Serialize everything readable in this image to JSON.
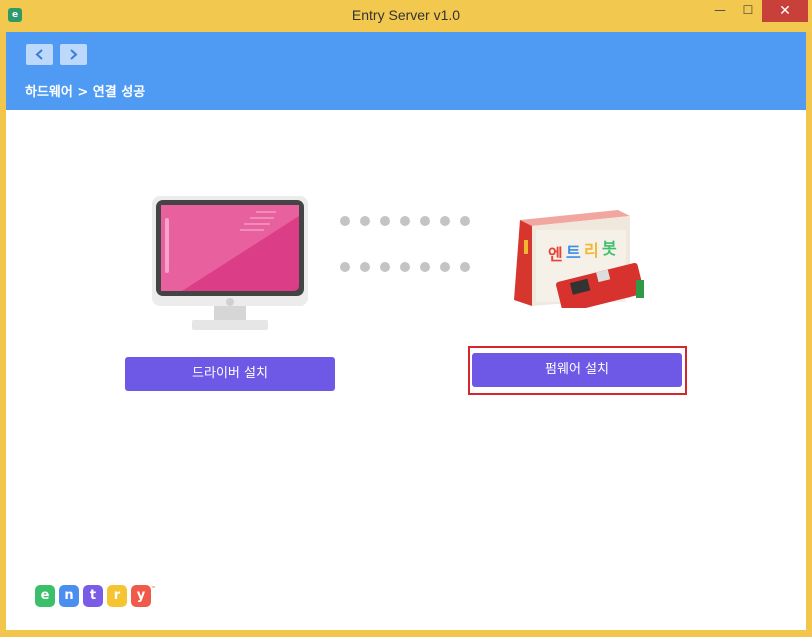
{
  "window": {
    "title": "Entry Server v1.0",
    "app_icon_glyph": "e",
    "controls": {
      "minimize": "—",
      "maximize": "☐",
      "close": "✕"
    }
  },
  "header": {
    "breadcrumb": "하드웨어 > 연결 성공",
    "nav": [
      "chevron-left-icon",
      "chevron-right-icon"
    ],
    "color": "#4f9bf3"
  },
  "main": {
    "illustrations": [
      "monitor-icon",
      "connection-dots",
      "hardware-board-image"
    ],
    "driver_button": "드라이버 설치",
    "firmware_button": "펌웨어 설치",
    "button_color": "#6e58e6",
    "highlight_color": "#d6262d"
  },
  "footer": {
    "logo_letters": [
      "e",
      "n",
      "t",
      "r",
      "y"
    ],
    "logo_colors": [
      "#3bbf6b",
      "#4a8ff0",
      "#7a5ce6",
      "#f5c432",
      "#ef5a4a"
    ],
    "trademark": "™"
  }
}
